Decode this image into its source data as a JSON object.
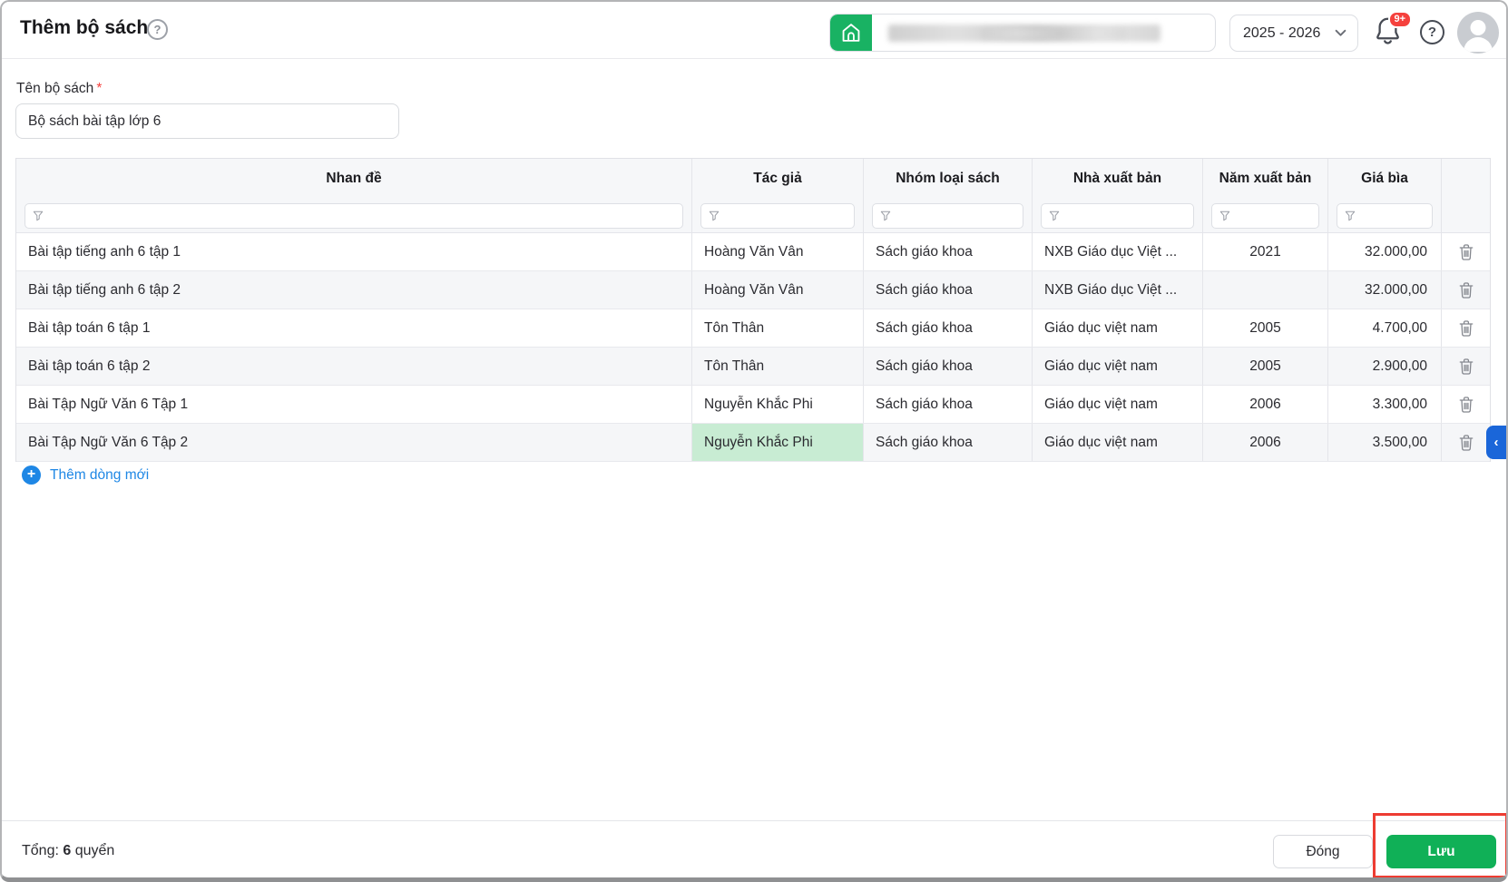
{
  "page": {
    "title": "Thêm bộ sách"
  },
  "header": {
    "school_year": "2025 - 2026",
    "notification_badge": "9+",
    "school_name_redacted": true
  },
  "form": {
    "name_label": "Tên bộ sách",
    "name_value": "Bộ sách bài tập lớp 6"
  },
  "table": {
    "columns": [
      "Nhan đề",
      "Tác giả",
      "Nhóm loại sách",
      "Nhà xuất bản",
      "Năm xuất bản",
      "Giá bìa"
    ],
    "rows": [
      {
        "title": "Bài tập tiếng anh 6 tập 1",
        "author": "Hoàng Văn Vân",
        "category": "Sách giáo khoa",
        "publisher": "NXB Giáo dục Việt ...",
        "year": "2021",
        "price": "32.000,00",
        "author_highlighted": false
      },
      {
        "title": "Bài tập tiếng anh 6 tập 2",
        "author": "Hoàng Văn Vân",
        "category": "Sách giáo khoa",
        "publisher": "NXB Giáo dục Việt ...",
        "year": "",
        "price": "32.000,00",
        "author_highlighted": false
      },
      {
        "title": "Bài tập toán 6 tập 1",
        "author": "Tôn Thân",
        "category": "Sách giáo khoa",
        "publisher": "Giáo dục việt nam",
        "year": "2005",
        "price": "4.700,00",
        "author_highlighted": false
      },
      {
        "title": "Bài tập toán 6 tập 2",
        "author": "Tôn Thân",
        "category": "Sách giáo khoa",
        "publisher": "Giáo dục việt nam",
        "year": "2005",
        "price": "2.900,00",
        "author_highlighted": false
      },
      {
        "title": "Bài Tập Ngữ Văn 6 Tập 1",
        "author": "Nguyễn Khắc Phi",
        "category": "Sách giáo khoa",
        "publisher": "Giáo dục việt nam",
        "year": "2006",
        "price": "3.300,00",
        "author_highlighted": false
      },
      {
        "title": "Bài Tập Ngữ Văn 6 Tập 2",
        "author": "Nguyễn Khắc Phi",
        "category": "Sách giáo khoa",
        "publisher": "Giáo dục việt nam",
        "year": "2006",
        "price": "3.500,00",
        "author_highlighted": true
      }
    ],
    "add_row_label": "Thêm dòng mới"
  },
  "footer": {
    "total_prefix": "Tổng:",
    "total_value": "6",
    "total_suffix": "quyển",
    "close_label": "Đóng",
    "save_label": "Lưu"
  },
  "icons": {
    "help": "?",
    "plus": "+",
    "collapse_chevron": "‹",
    "required_asterisk": "*"
  },
  "colors": {
    "accent_green": "#10b057",
    "home_green": "#19b263",
    "accent_blue": "#1e87e5",
    "side_tab_blue": "#1a66d9",
    "highlight_green": "#c8ecd3",
    "badge_red": "#f5413d",
    "annotation_red": "#ed3c32"
  }
}
